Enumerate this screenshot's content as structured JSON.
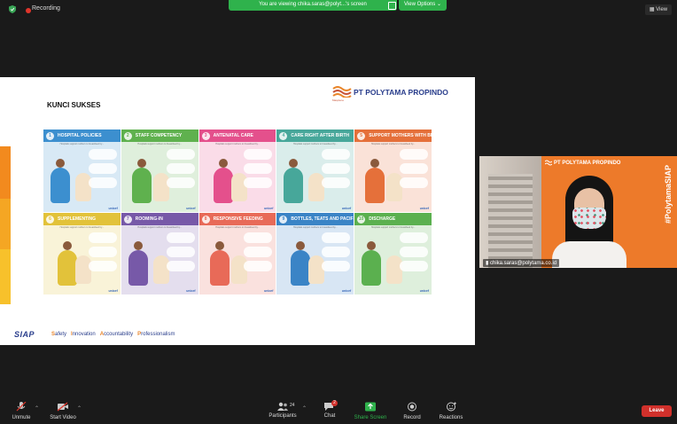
{
  "top_bar": {
    "recording_label": "Recording",
    "share_banner": "You are viewing chika.saras@polyt...'s screen",
    "view_options": "View Options",
    "view_button": "View"
  },
  "slide": {
    "heading": "KUNCI SUKSES",
    "company": "PT POLYTAMA PROPINDO",
    "logo_sub": "Masplene",
    "tiles": [
      {
        "num": "1",
        "title": "HOSPITAL POLICIES",
        "color": "#3c8fcf"
      },
      {
        "num": "2",
        "title": "STAFF COMPETENCY",
        "color": "#5fb14e"
      },
      {
        "num": "3",
        "title": "ANTENATAL CARE",
        "color": "#e4508c"
      },
      {
        "num": "4",
        "title": "CARE RIGHT AFTER BIRTH",
        "color": "#47a79a"
      },
      {
        "num": "5",
        "title": "SUPPORT MOTHERS WITH BREASTFEEDING",
        "color": "#e5703a"
      },
      {
        "num": "6",
        "title": "SUPPLEMENTING",
        "color": "#e2c23a"
      },
      {
        "num": "7",
        "title": "ROOMING-IN",
        "color": "#7759a8"
      },
      {
        "num": "8",
        "title": "RESPONSIVE FEEDING",
        "color": "#e86a58"
      },
      {
        "num": "9",
        "title": "BOTTLES, TEATS AND PACIFIERS",
        "color": "#3a84c6"
      },
      {
        "num": "10",
        "title": "DISCHARGE",
        "color": "#5bb04f"
      }
    ],
    "tile_subtitle": "Hospitals support mothers to breastfeed by...",
    "tile_footer": "unicef",
    "siap_logo": "SIAP",
    "values": [
      {
        "initial": "S",
        "rest": "afety"
      },
      {
        "initial": "I",
        "rest": "nnovation"
      },
      {
        "initial": "A",
        "rest": "ccountability"
      },
      {
        "initial": "P",
        "rest": "rofessionalism"
      }
    ]
  },
  "video": {
    "company": "PT POLYTAMA PROPINDO",
    "hashtag": "#PolytamaSIAP",
    "participant_name": "chika.saras@polytama.co.id"
  },
  "toolbar": {
    "unmute": "Unmute",
    "start_video": "Start Video",
    "participants": "Participants",
    "participants_count": "24",
    "chat": "Chat",
    "chat_badge": "2",
    "share_screen": "Share Screen",
    "record": "Record",
    "reactions": "Reactions",
    "leave": "Leave"
  },
  "colors": {
    "share_green": "#2fb24c",
    "leave_red": "#d0302b",
    "video_orange": "#ed7a2a"
  }
}
